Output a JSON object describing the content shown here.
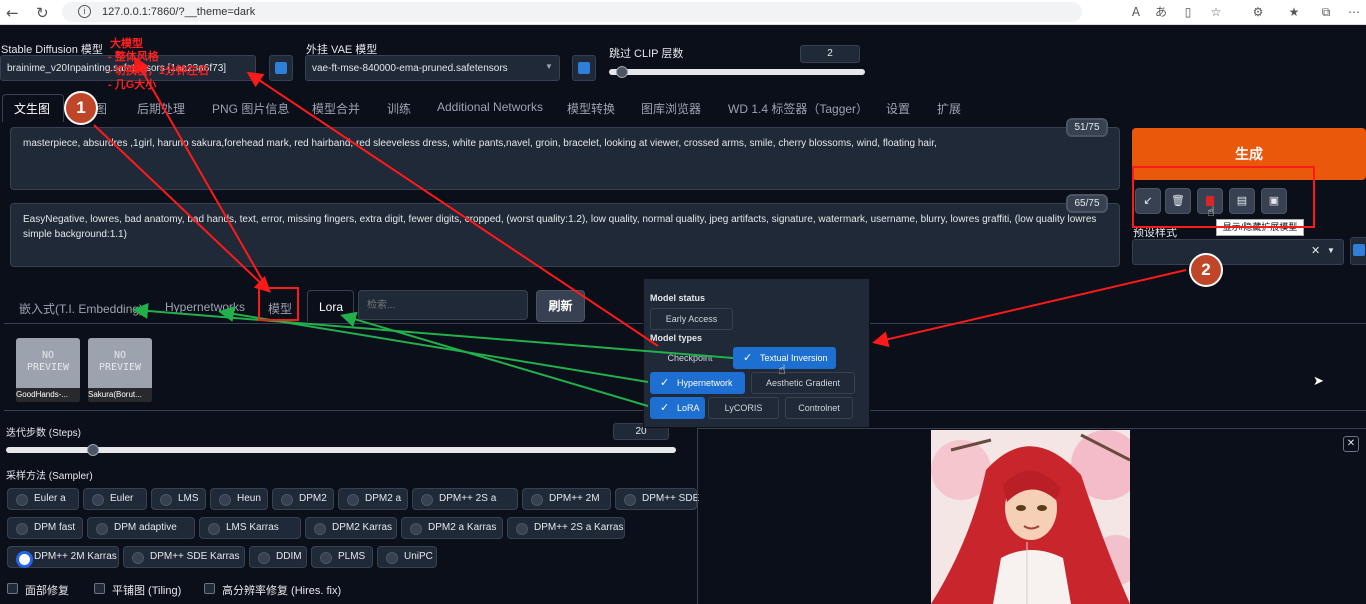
{
  "browser": {
    "url": "127.0.0.1:7860/?__theme=dark"
  },
  "model": {
    "sd_label": "Stable Diffusion 模型",
    "sd_value": "brainime_v20Inpainting.safetensors [1aa23a6f73]",
    "vae_label": "外挂 VAE 模型",
    "vae_value": "vae-ft-mse-840000-ema-pruned.safetensors",
    "clip_label": "跳过 CLIP 层数",
    "clip_value": "2"
  },
  "tabs": [
    "文生图",
    "图生图",
    "后期处理",
    "PNG 图片信息",
    "模型合并",
    "训练",
    "Additional Networks",
    "模型转换",
    "图库浏览器",
    "WD 1.4 标签器（Tagger）",
    "设置",
    "扩展"
  ],
  "prompt": {
    "positive": "masterpiece, absurdres ,1girl, haruno sakura,forehead mark, red hairband, red sleeveless dress, white pants,navel,   groin,   bracelet, looking at viewer, crossed arms, smile, cherry blossoms, wind, floating hair,",
    "positive_count": "51/75",
    "negative": "EasyNegative, lowres, bad anatomy, bad hands, text, error, missing fingers, extra digit, fewer digits, cropped, (worst quality:1.2), low quality, normal quality, jpeg artifacts, signature, watermark, username, blurry, lowres graffiti, (low quality lowres simple background:1.1)",
    "negative_count": "65/75"
  },
  "generate": {
    "label": "生成",
    "style_label": "预设样式",
    "tooltip": "显示/隐藏扩展模型"
  },
  "networks": {
    "tabs": [
      "嵌入式(T.I. Embedding)",
      "Hypernetworks",
      "模型",
      "Lora"
    ],
    "search_placeholder": "检索...",
    "refresh": "刷新",
    "cards": [
      {
        "preview": "NO\nPREVIEW",
        "name": "GoodHands-..."
      },
      {
        "preview": "NO\nPREVIEW",
        "name": "Sakura(Borut..."
      }
    ]
  },
  "steps": {
    "label": "迭代步数 (Steps)",
    "value": "20",
    "fraction": 0.13
  },
  "clip_fraction": 0.05,
  "sampler": {
    "label": "采样方法 (Sampler)",
    "selected": "DPM++ 2M Karras",
    "rows": [
      [
        "Euler a",
        "Euler",
        "LMS",
        "Heun",
        "DPM2",
        "DPM2 a",
        "DPM++ 2S a",
        "DPM++ 2M",
        "DPM++ SDE"
      ],
      [
        "DPM fast",
        "DPM adaptive",
        "LMS Karras",
        "DPM2 Karras",
        "DPM2 a Karras",
        "DPM++ 2S a Karras"
      ],
      [
        "DPM++ 2M Karras",
        "DPM++ SDE Karras",
        "DDIM",
        "PLMS",
        "UniPC"
      ]
    ]
  },
  "checkboxes": [
    "面部修复",
    "平铺图 (Tiling)",
    "高分辨率修复 (Hires. fix)"
  ],
  "popup": {
    "status_label": "Model status",
    "early": "Early Access",
    "types_label": "Model types",
    "checkpoint": "Checkpoint",
    "ti": "Textual Inversion",
    "hyper": "Hypernetwork",
    "aesthetic": "Aesthetic Gradient",
    "lora": "LoRA",
    "lycoris": "LyCORIS",
    "controlnet": "Controlnet"
  },
  "annotations": {
    "big_model": "大模型",
    "style": "- 整体风格",
    "switch": "- 切换慢，1分钟左右",
    "size": "- 几G大小",
    "step1": "1",
    "step2": "2"
  },
  "colors": {
    "bg": "#0b0f19",
    "accent": "#ea580c",
    "annotation": "#ff2020",
    "arrow_green": "#22b04a",
    "selected": "#1d6fd1"
  }
}
